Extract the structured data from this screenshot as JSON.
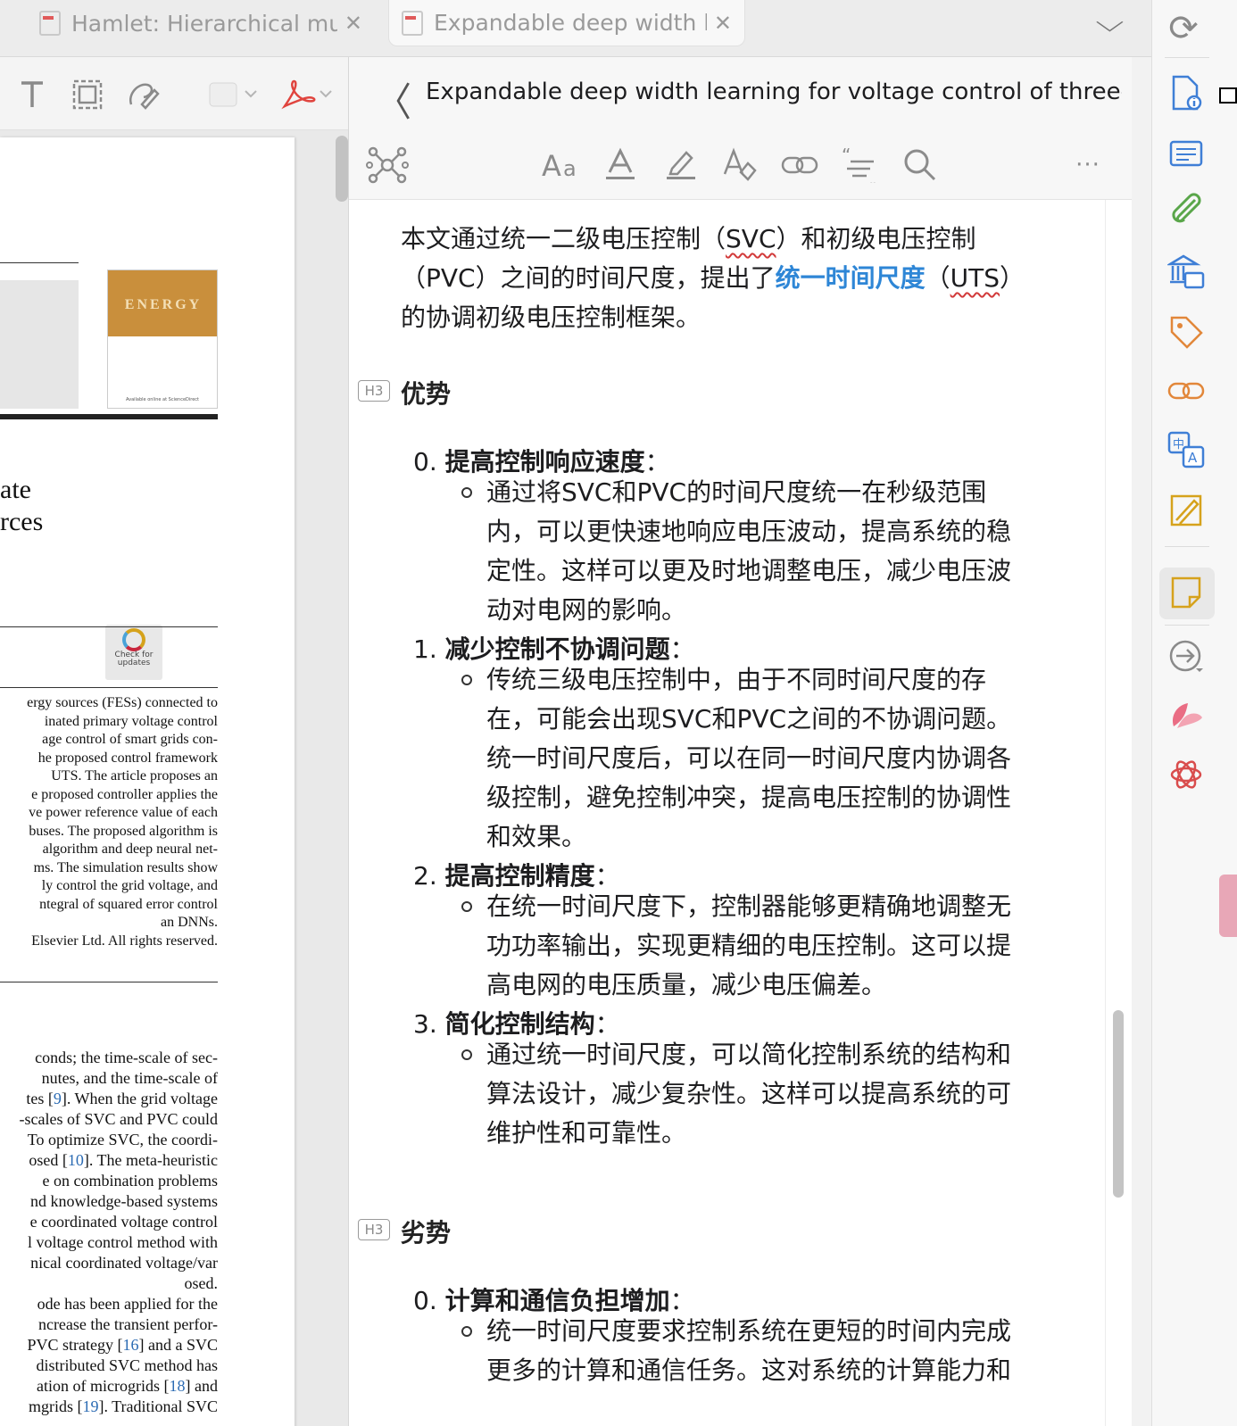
{
  "tabs": [
    {
      "label": "Hamlet: Hierarchical mul",
      "close": "✕"
    },
    {
      "label": "Expandable deep width l",
      "close": "✕"
    }
  ],
  "tab_dropdown": "⌵",
  "sync_icon": "⟳",
  "pdf": {
    "cover_title": "ENERGY",
    "cover_foot": "Available online at ScienceDirect",
    "title_line1": "ate",
    "title_line2": "rces",
    "check_label": "Check for updates",
    "abstract_lines": [
      "ergy sources (FESs) connected to",
      "inated primary voltage control",
      "age control of smart grids con-",
      "he proposed control framework",
      "UTS. The article proposes an",
      "e proposed controller applies the",
      "ve power reference value of each",
      "buses. The proposed algorithm is",
      "algorithm and deep neural net-",
      "ms. The simulation results show",
      "ly control the grid voltage, and",
      "ntegral of squared error control",
      "an DNNs.",
      "Elsevier Ltd. All rights reserved."
    ],
    "body_lines": [
      {
        "pre": "conds; the time-scale of sec-",
        "cite": "",
        "post": ""
      },
      {
        "pre": "nutes, and the time-scale of",
        "cite": "",
        "post": ""
      },
      {
        "pre": "tes [",
        "cite": "9",
        "post": "]. When the grid voltage"
      },
      {
        "pre": "-scales of SVC and PVC could",
        "cite": "",
        "post": ""
      },
      {
        "pre": "To optimize SVC, the coordi-",
        "cite": "",
        "post": ""
      },
      {
        "pre": "osed [",
        "cite": "10",
        "post": "]. The meta-heuristic"
      },
      {
        "pre": "e on combination problems",
        "cite": "",
        "post": ""
      },
      {
        "pre": "nd knowledge-based systems",
        "cite": "",
        "post": ""
      },
      {
        "pre": "e coordinated voltage control",
        "cite": "",
        "post": ""
      },
      {
        "pre": "l voltage control method with",
        "cite": "",
        "post": ""
      },
      {
        "pre": "nical coordinated voltage/var",
        "cite": "",
        "post": ""
      },
      {
        "pre": "osed.",
        "cite": "",
        "post": ""
      },
      {
        "pre": "ode has been applied for the",
        "cite": "",
        "post": ""
      },
      {
        "pre": "ncrease the transient perfor-",
        "cite": "",
        "post": ""
      },
      {
        "pre": "PVC strategy [",
        "cite": "16",
        "post": "] and a SVC"
      },
      {
        "pre": "distributed SVC method has",
        "cite": "",
        "post": ""
      },
      {
        "pre": "ation of microgrids [",
        "cite": "18",
        "post": "] and"
      },
      {
        "pre": "mgrids [",
        "cite": "19",
        "post": "]. Traditional SVC"
      }
    ]
  },
  "note": {
    "back": "〈",
    "title": "Expandable deep width learning for voltage control of three-sta...",
    "intro_a": "本文通过统一二级电压控制（",
    "intro_svc": "SVC",
    "intro_b": "）和初级电压控制（PVC）之间的时间尺度，提出了",
    "intro_hl": "统一时间尺度",
    "intro_c": "（",
    "intro_uts": "UTS",
    "intro_d": "）的协调初级电压控制框架。",
    "h3_tag": "H3",
    "adv_heading": "优势",
    "adv_items": [
      {
        "num": "0.",
        "title": "提高控制响应速度",
        "colon": "：",
        "detail": "通过将SVC和PVC的时间尺度统一在秒级范围内，可以更快速地响应电压波动，提高系统的稳定性。这样可以更及时地调整电压，减少电压波动对电网的影响。"
      },
      {
        "num": "1.",
        "title": "减少控制不协调问题",
        "colon": "：",
        "detail": "传统三级电压控制中，由于不同时间尺度的存在，可能会出现SVC和PVC之间的不协调问题。统一时间尺度后，可以在同一时间尺度内协调各级控制，避免控制冲突，提高电压控制的协调性和效果。"
      },
      {
        "num": "2.",
        "title": "提高控制精度",
        "colon": "：",
        "detail": "在统一时间尺度下，控制器能够更精确地调整无功功率输出，实现更精细的电压控制。这可以提高电网的电压质量，减少电压偏差。"
      },
      {
        "num": "3.",
        "title": "简化控制结构",
        "colon": "：",
        "detail": "通过统一时间尺度，可以简化控制系统的结构和算法设计，减少复杂性。这样可以提高系统的可维护性和可靠性。"
      }
    ],
    "dis_heading": "劣势",
    "dis_items": [
      {
        "num": "0.",
        "title": "计算和通信负担增加",
        "colon": "：",
        "detail": "统一时间尺度要求控制系统在更短的时间内完成更多的计算和通信任务。这对系统的计算能力和"
      }
    ]
  },
  "toolbar": {
    "more": "···"
  },
  "icons": {
    "pdf_tools": [
      "text-tool-icon",
      "area-select-icon",
      "draw-icon",
      "color-swatch-icon",
      "acrobat-icon"
    ],
    "note_tools": [
      "mindmap-icon",
      "font-size-icon",
      "text-color-icon",
      "highlight-icon",
      "clear-format-icon",
      "link-icon",
      "quote-icon",
      "search-icon",
      "more-icon"
    ],
    "rightbar": [
      "doc-info-icon",
      "outline-icon",
      "attachment-icon",
      "library-icon",
      "tag-icon",
      "related-icon",
      "translate-icon",
      "annotate-icon",
      "note-icon",
      "export-icon",
      "petal-app-icon",
      "openai-icon"
    ]
  },
  "colors": {
    "accent_blue": "#2e86d6",
    "rightbar_blue": "#3f7fd6",
    "rightbar_green": "#5aa64a",
    "rightbar_orange": "#e2873a",
    "rightbar_yellow": "#d6a21c",
    "rightbar_red": "#d94d4d"
  }
}
